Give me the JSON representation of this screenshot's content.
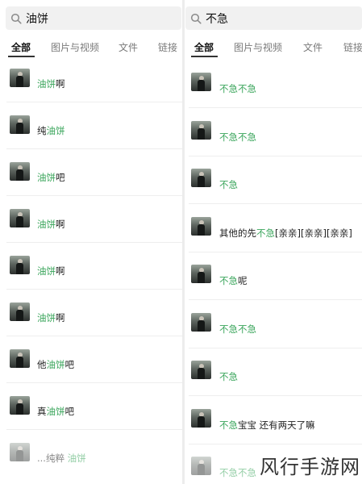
{
  "left": {
    "query": "油饼",
    "tabs": [
      "全部",
      "图片与视频",
      "文件",
      "链接"
    ],
    "results": [
      {
        "pre": "",
        "hl": "油饼",
        "post": "啊"
      },
      {
        "pre": "纯",
        "hl": "油饼",
        "post": ""
      },
      {
        "pre": "",
        "hl": "油饼",
        "post": "吧"
      },
      {
        "pre": "",
        "hl": "油饼",
        "post": "啊"
      },
      {
        "pre": "",
        "hl": "油饼",
        "post": "啊"
      },
      {
        "pre": "",
        "hl": "油饼",
        "post": "啊"
      },
      {
        "pre": "他",
        "hl": "油饼",
        "post": "吧"
      },
      {
        "pre": "真",
        "hl": "油饼",
        "post": "吧"
      },
      {
        "pre": "...纯粹 ",
        "hl": "油饼",
        "post": ""
      }
    ]
  },
  "right": {
    "query": "不急",
    "tabs": [
      "全部",
      "图片与视频",
      "文件",
      "链接"
    ],
    "results": [
      {
        "pre": "",
        "hl": "不急不急",
        "post": ""
      },
      {
        "pre": "",
        "hl": "不急不急",
        "post": ""
      },
      {
        "pre": "",
        "hl": "不急",
        "post": ""
      },
      {
        "pre": "其他的先",
        "hl": "不急",
        "post": "[亲亲][亲亲][亲亲]"
      },
      {
        "pre": "",
        "hl": "不急",
        "post": "呢"
      },
      {
        "pre": "",
        "hl": "不急不急",
        "post": ""
      },
      {
        "pre": "",
        "hl": "不急",
        "post": ""
      },
      {
        "pre": "",
        "hl": "不急",
        "post": "宝宝 还有两天了嘛"
      },
      {
        "pre": "",
        "hl": "不急不急",
        "post": ""
      }
    ]
  },
  "watermark": "风行手游网",
  "colors": {
    "highlight": "#3aa55b",
    "search_bg": "#f1f1f1"
  }
}
